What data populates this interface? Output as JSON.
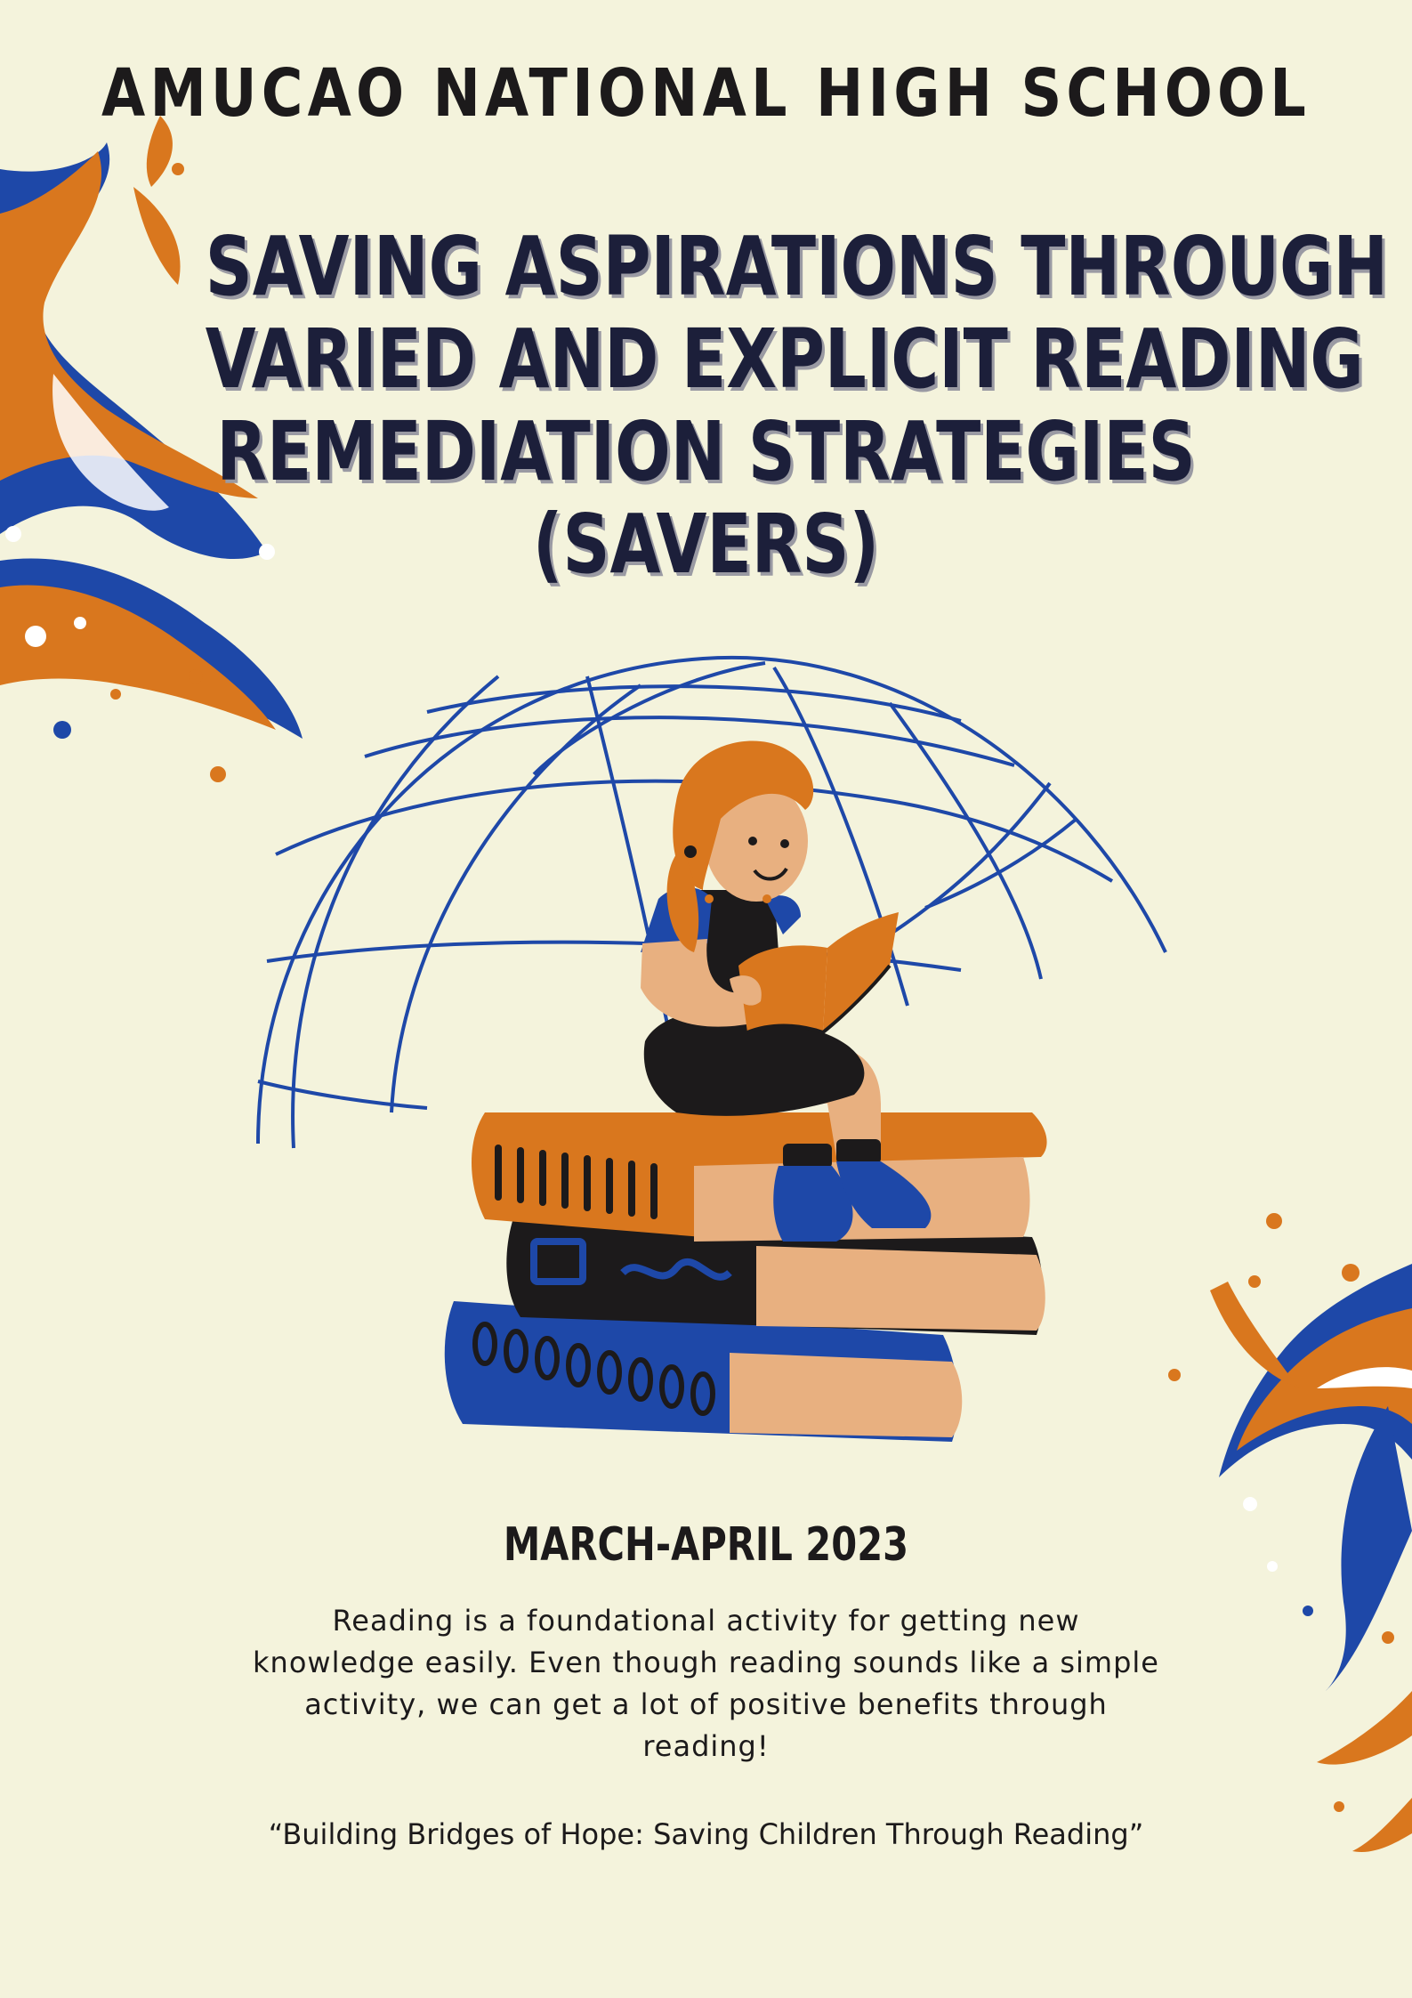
{
  "header": {
    "school": "AMUCAO NATIONAL HIGH SCHOOL"
  },
  "title": {
    "line1": "SAVING ASPIRATIONS THROUGH",
    "line2": "VARIED AND EXPLICIT READING",
    "line3": "REMEDIATION STRATEGIES",
    "line4": "(SAVERS)"
  },
  "event": {
    "date": "MARCH-APRIL 2023"
  },
  "description": {
    "line1": "Reading is a foundational activity for getting new",
    "line2": "knowledge easily. Even though reading sounds like a simple",
    "line3": "activity, we can get a lot of positive benefits through",
    "line4": "reading!"
  },
  "tagline": "“Building Bridges of Hope: Saving Children Through Reading”",
  "colors": {
    "background": "#f4f3dc",
    "orange": "#d9771e",
    "blue": "#1e48a8",
    "dark": "#1c1a1b",
    "skin": "#e8b080"
  },
  "illustration": {
    "subject": "girl-reading-on-book-stack",
    "background": "globe-wireframe"
  }
}
